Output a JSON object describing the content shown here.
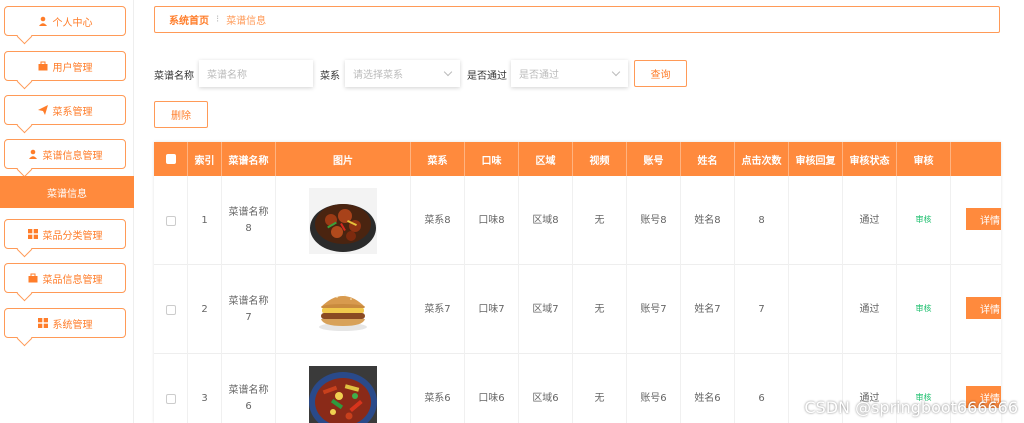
{
  "sidebar": {
    "items": [
      {
        "label": "个人中心",
        "icon": "user-icon"
      },
      {
        "label": "用户管理",
        "icon": "briefcase-icon"
      },
      {
        "label": "菜系管理",
        "icon": "send-icon"
      },
      {
        "label": "菜谱信息管理",
        "icon": "user-icon"
      },
      {
        "label": "菜品分类管理",
        "icon": "grid-icon"
      },
      {
        "label": "菜品信息管理",
        "icon": "briefcase-icon"
      },
      {
        "label": "系统管理",
        "icon": "grid-icon"
      }
    ],
    "active_label": "菜谱信息"
  },
  "breadcrumb": {
    "home": "系统首页",
    "separator": "⁝",
    "current": "菜谱信息"
  },
  "search": {
    "name_label": "菜谱名称",
    "name_placeholder": "菜谱名称",
    "cuisine_label": "菜系",
    "cuisine_placeholder": "请选择菜系",
    "approved_label": "是否通过",
    "approved_placeholder": "是否通过",
    "query_button": "查询"
  },
  "toolbar": {
    "delete_button": "删除"
  },
  "table": {
    "headers": [
      "索引",
      "菜谱名称",
      "图片",
      "菜系",
      "口味",
      "区域",
      "视频",
      "账号",
      "姓名",
      "点击次数",
      "审核回复",
      "审核状态",
      "审核"
    ],
    "rows": [
      {
        "index": "1",
        "name": "菜谱名称8",
        "image": "braised-chicken-dish",
        "cuisine": "菜系8",
        "taste": "口味8",
        "region": "区域8",
        "video": "无",
        "account": "账号8",
        "person": "姓名8",
        "clicks": "8",
        "reply": "",
        "status": "通过",
        "audit": "审核",
        "detail": "详情"
      },
      {
        "index": "2",
        "name": "菜谱名称7",
        "image": "burger-dish",
        "cuisine": "菜系7",
        "taste": "口味7",
        "region": "区域7",
        "video": "无",
        "account": "账号7",
        "person": "姓名7",
        "clicks": "7",
        "reply": "",
        "status": "通过",
        "audit": "审核",
        "detail": "详情"
      },
      {
        "index": "3",
        "name": "菜谱名称6",
        "image": "stir-fry-dish",
        "cuisine": "菜系6",
        "taste": "口味6",
        "region": "区域6",
        "video": "无",
        "account": "账号6",
        "person": "姓名6",
        "clicks": "6",
        "reply": "",
        "status": "通过",
        "audit": "审核",
        "detail": "详情"
      }
    ]
  },
  "watermark": "CSDN @springboot666666",
  "colors": {
    "accent": "#ff8a3d",
    "accent_border": "#ff9a57",
    "audit_green": "#19be6b"
  }
}
